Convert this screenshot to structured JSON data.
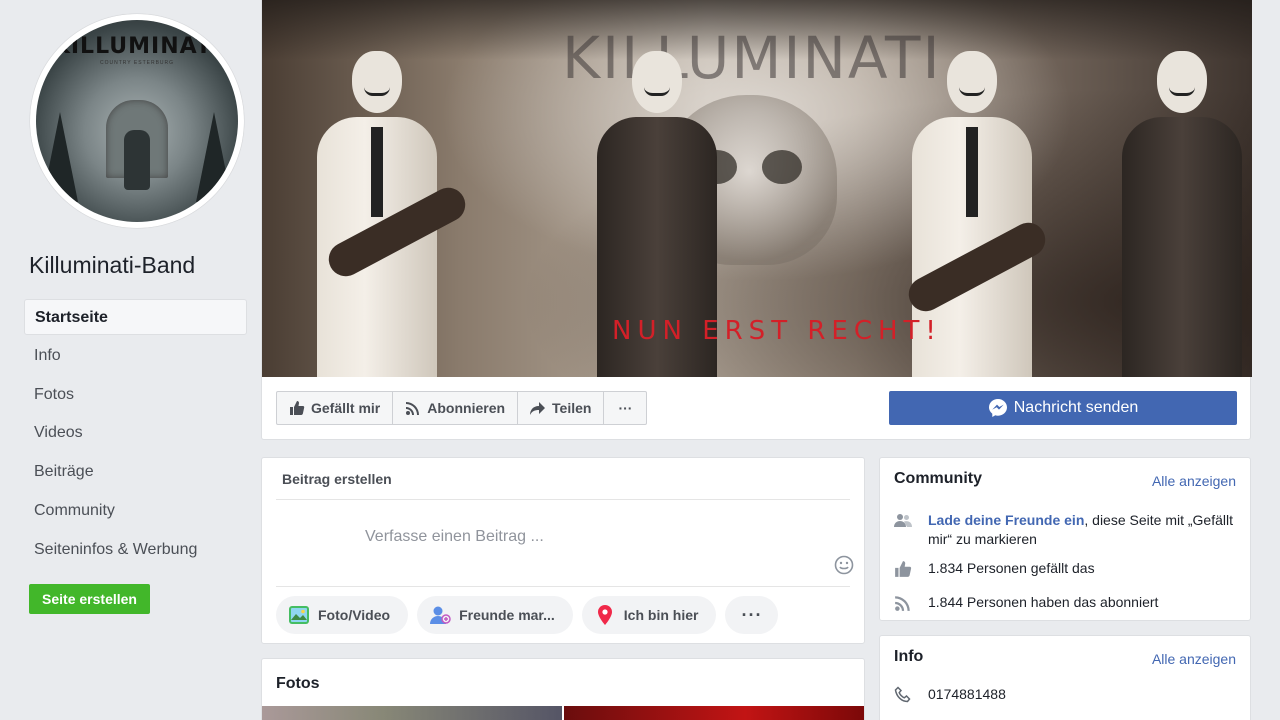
{
  "page": {
    "name": "Killuminati-Band",
    "logo_text": "KILLUMINATI",
    "logo_subtitle": "COUNTRY ESTERBURG",
    "cover_band_text": "KILLUMINATI",
    "cover_slogan": "NUN ERST RECHT!"
  },
  "sidebar": {
    "items": [
      {
        "label": "Startseite",
        "active": true
      },
      {
        "label": "Info"
      },
      {
        "label": "Fotos"
      },
      {
        "label": "Videos"
      },
      {
        "label": "Beiträge"
      },
      {
        "label": "Community"
      },
      {
        "label": "Seiteninfos & Werbung"
      }
    ],
    "create_page": "Seite erstellen"
  },
  "actions": {
    "like": "Gefällt mir",
    "follow": "Abonnieren",
    "share": "Teilen",
    "more": "···",
    "send_message": "Nachricht senden"
  },
  "composer": {
    "title": "Beitrag erstellen",
    "placeholder": "Verfasse einen Beitrag ...",
    "photo_video": "Foto/Video",
    "tag_friends": "Freunde mar...",
    "checkin": "Ich bin hier",
    "more": "···"
  },
  "photos": {
    "title": "Fotos"
  },
  "community": {
    "title": "Community",
    "see_all": "Alle anzeigen",
    "invite_link": "Lade deine Freunde ein",
    "invite_text": ", diese Seite mit „Gefällt mir“ zu markieren",
    "likes": "1.834 Personen gefällt das",
    "followers": "1.844 Personen haben das abonniert"
  },
  "info": {
    "title": "Info",
    "see_all": "Alle anzeigen",
    "phone": "0174881488"
  },
  "colors": {
    "brand_blue": "#4267b2",
    "create_green": "#42b72a",
    "slogan_red": "#d32028"
  }
}
